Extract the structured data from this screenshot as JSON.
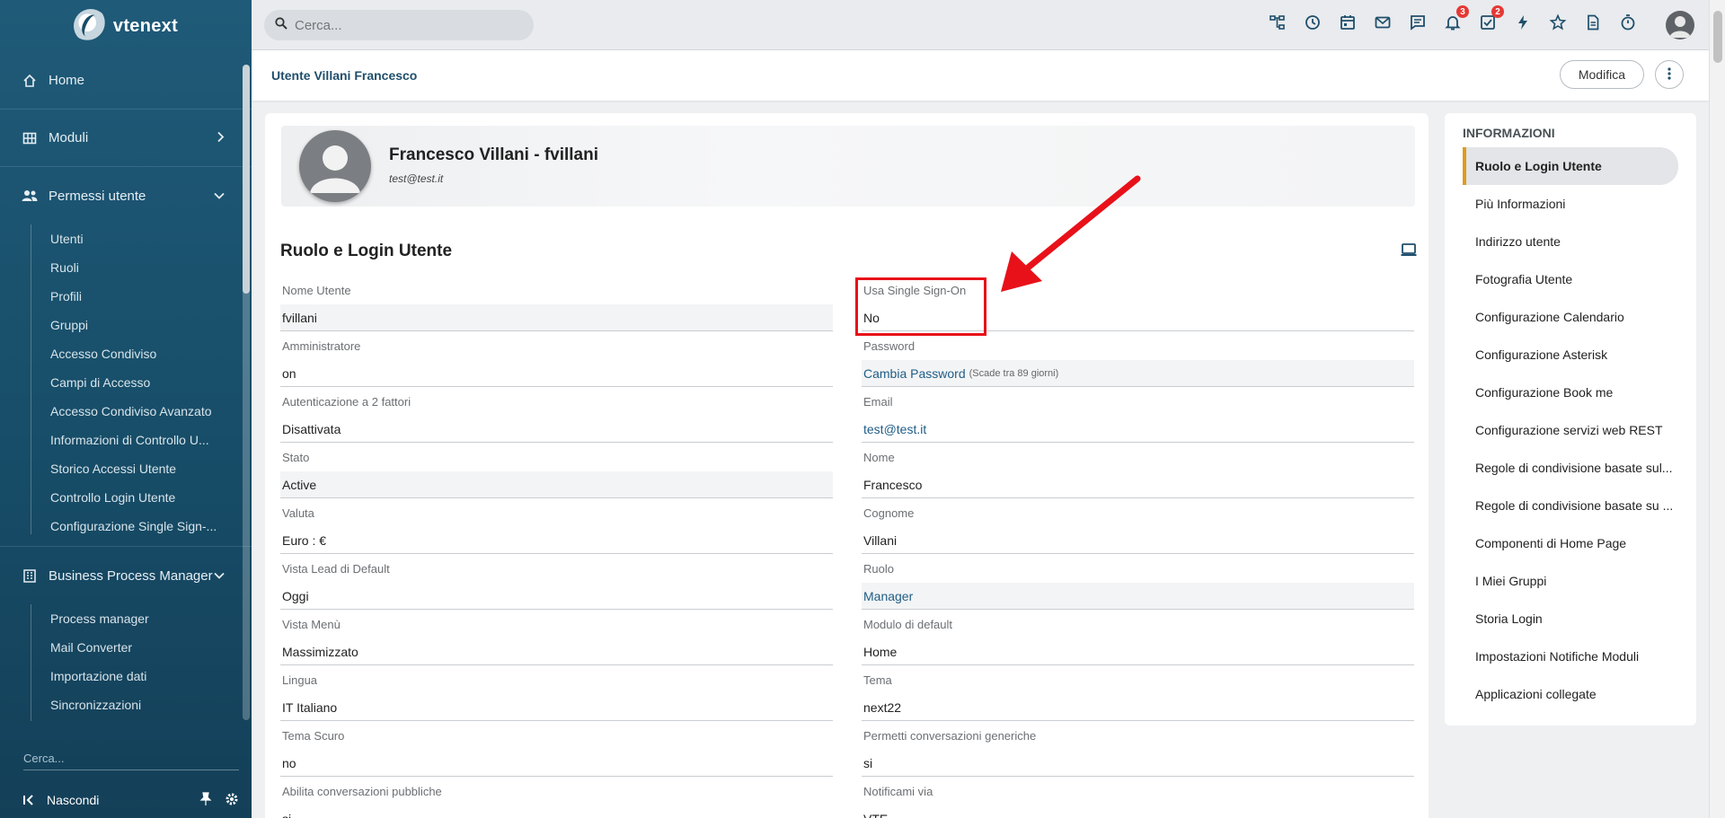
{
  "app": {
    "logo_text": "vtenext"
  },
  "sidebar": {
    "main": [
      {
        "label": "Home",
        "icon": "home-icon"
      },
      {
        "label": "Moduli",
        "icon": "grid-icon"
      },
      {
        "label": "Permessi utente",
        "icon": "users-icon"
      }
    ],
    "permessi_items": [
      "Utenti",
      "Ruoli",
      "Profili",
      "Gruppi",
      "Accesso Condiviso",
      "Campi di Accesso",
      "Accesso Condiviso Avanzato",
      "Informazioni di Controllo U...",
      "Storico Accessi Utente",
      "Controllo Login Utente",
      "Configurazione Single Sign-..."
    ],
    "bpm": {
      "label": "Business Process Manager",
      "icon": "building-icon"
    },
    "bpm_items": [
      "Process manager",
      "Mail Converter",
      "Importazione dati",
      "Sincronizzazioni"
    ],
    "search_placeholder": "Cerca...",
    "footer_label": "Nascondi"
  },
  "topbar": {
    "search_placeholder": "Cerca...",
    "notifications_count": "3",
    "tasks_count": "2"
  },
  "page": {
    "breadcrumb": "Utente Villani Francesco",
    "edit_button": "Modifica"
  },
  "profile": {
    "name": "Francesco Villani - fvillani",
    "email": "test@test.it"
  },
  "section": {
    "title": "Ruolo e Login Utente"
  },
  "fields": [
    {
      "left": {
        "label": "Nome Utente",
        "value": "fvillani"
      },
      "right": {
        "label": "Usa Single Sign-On",
        "value": "No"
      }
    },
    {
      "left": {
        "label": "Amministratore",
        "value": "on"
      },
      "right": {
        "label": "Password",
        "value": "Cambia Password",
        "note": "(Scade tra 89 giorni)"
      }
    },
    {
      "left": {
        "label": "Autenticazione a 2 fattori",
        "value": "Disattivata"
      },
      "right": {
        "label": "Email",
        "value": "test@test.it"
      }
    },
    {
      "left": {
        "label": "Stato",
        "value": "Active"
      },
      "right": {
        "label": "Nome",
        "value": "Francesco"
      }
    },
    {
      "left": {
        "label": "Valuta",
        "value": "Euro : €"
      },
      "right": {
        "label": "Cognome",
        "value": "Villani"
      }
    },
    {
      "left": {
        "label": "Vista Lead di Default",
        "value": "Oggi"
      },
      "right": {
        "label": "Ruolo",
        "value": "Manager"
      }
    },
    {
      "left": {
        "label": "Vista Menù",
        "value": "Massimizzato"
      },
      "right": {
        "label": "Modulo di default",
        "value": "Home"
      }
    },
    {
      "left": {
        "label": "Lingua",
        "value": "IT Italiano"
      },
      "right": {
        "label": "Tema",
        "value": "next22"
      }
    },
    {
      "left": {
        "label": "Tema Scuro",
        "value": "no"
      },
      "right": {
        "label": "Permetti conversazioni generiche",
        "value": "si"
      }
    },
    {
      "left": {
        "label": "Abilita conversazioni pubbliche",
        "value": "si"
      },
      "right": {
        "label": "Notificami via",
        "value": "VTE"
      }
    }
  ],
  "info": {
    "title": "INFORMAZIONI",
    "items": [
      "Ruolo e Login Utente",
      "Più Informazioni",
      "Indirizzo utente",
      "Fotografia Utente",
      "Configurazione Calendario",
      "Configurazione Asterisk",
      "Configurazione Book me",
      "Configurazione servizi web REST",
      "Regole di condivisione basate sul...",
      "Regole di condivisione basate su ...",
      "Componenti di Home Page",
      "I Miei Gruppi",
      "Storia Login",
      "Impostazioni Notifiche Moduli",
      "Applicazioni collegate"
    ]
  },
  "colors": {
    "sidebar": "#174d68",
    "accent": "#e09b17",
    "link": "#1f5d86",
    "annotation": "#e8111a"
  }
}
